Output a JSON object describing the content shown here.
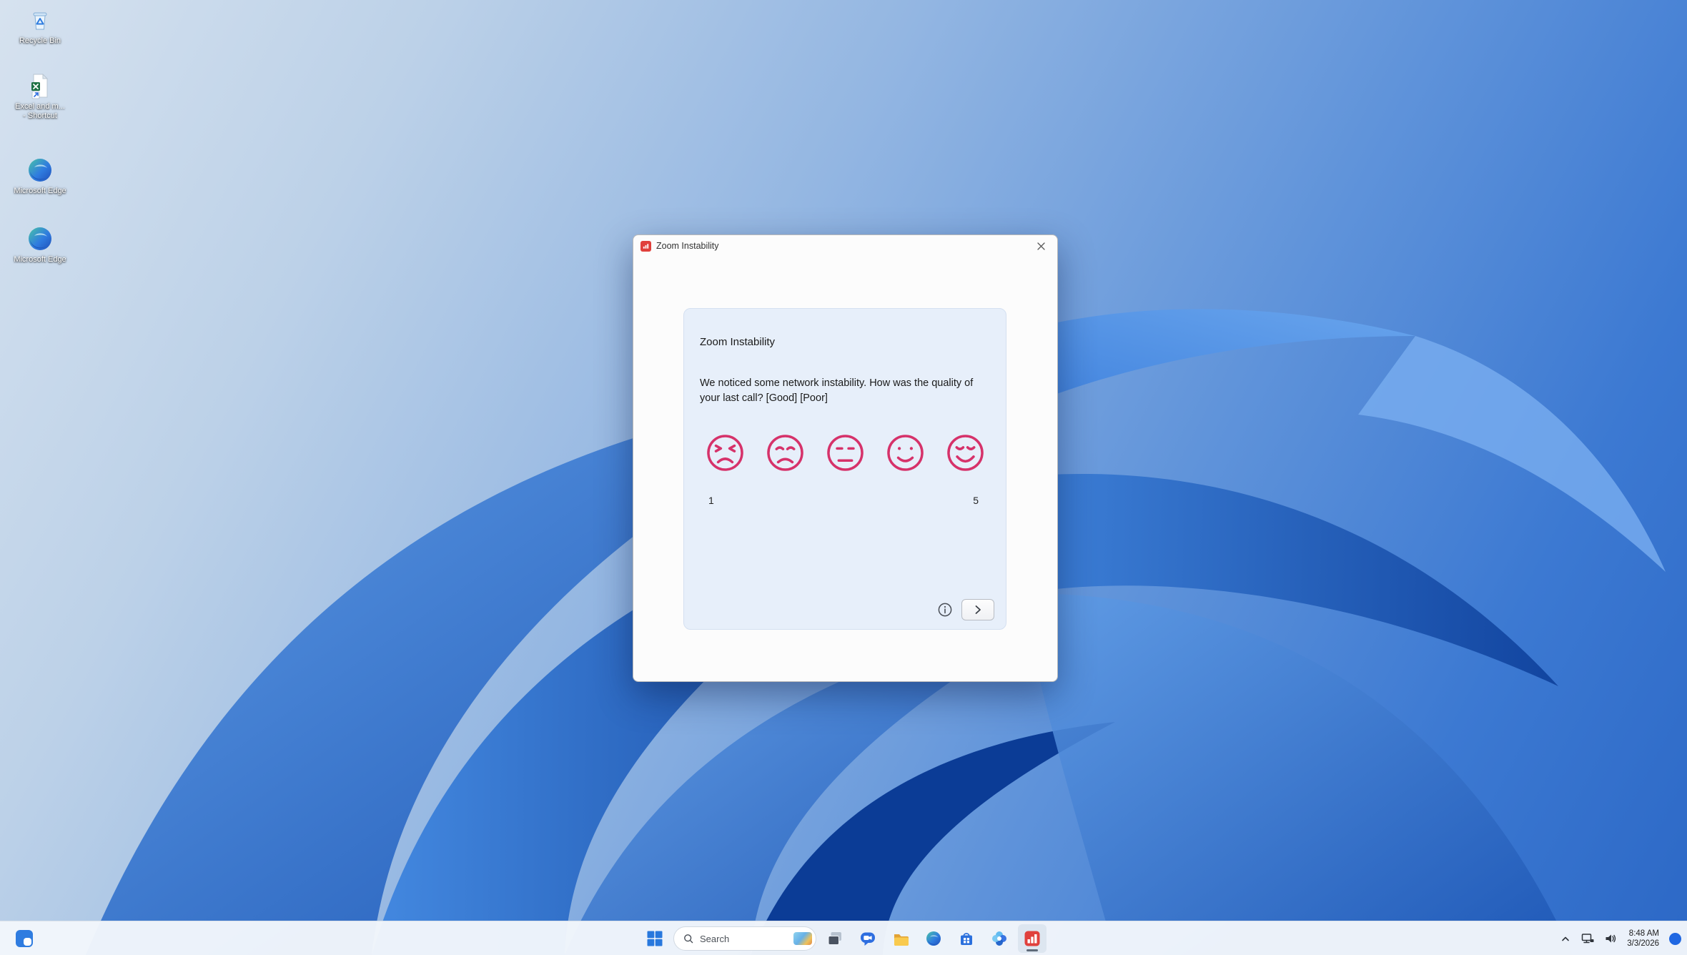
{
  "desktop": {
    "icons": [
      {
        "label": "Recycle Bin"
      },
      {
        "label_line1": "Excel and m...",
        "label_line2": "- Shortcut"
      },
      {
        "label": "Microsoft Edge"
      },
      {
        "label": "Microsoft Edge"
      }
    ]
  },
  "dialog": {
    "title": "Zoom Instability",
    "survey": {
      "heading": "Zoom Instability",
      "question": "We noticed some network instability. How was the quality of your last call? [Good] [Poor]",
      "scale_min": "1",
      "scale_max": "5",
      "faces": [
        "angry-squint",
        "sad",
        "neutral",
        "smile",
        "grin"
      ]
    }
  },
  "taskbar": {
    "search_label": "Search",
    "tray": {
      "time": "8:48 AM",
      "date": "3/3/2026"
    }
  },
  "icon_names": [
    "recycle-bin-icon",
    "excel-shortcut-icon",
    "edge-icon",
    "start-icon",
    "search-icon",
    "task-view-icon",
    "chat-icon",
    "file-explorer-icon",
    "store-icon",
    "photos-icon",
    "survey-app-icon",
    "chevron-up-icon",
    "network-icon",
    "volume-icon",
    "info-icon",
    "next-arrow-icon",
    "close-icon"
  ],
  "colors": {
    "face_accent": "#d6326a",
    "survey_panel": "#e7effa",
    "app_red": "#e0403c",
    "taskbar_bg": "#f2f6fb",
    "badge_blue": "#1f67e2"
  }
}
